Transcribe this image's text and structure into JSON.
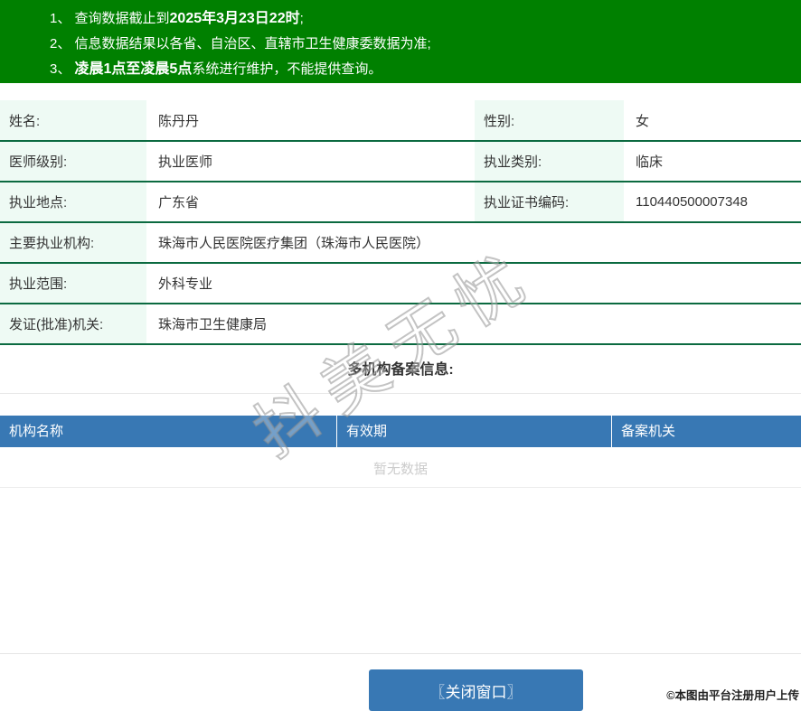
{
  "banner": {
    "lines": [
      {
        "seg1": "1、 查询数据截止到",
        "seg2": "2025年3月23日22时",
        "seg3": ";"
      },
      {
        "seg1": "2、 信息数据结果以各省、自治区、直辖市卫生健康委数据为准;",
        "seg2": "",
        "seg3": ""
      },
      {
        "seg1": "3、 ",
        "seg2": "凌晨1点至凌晨5点",
        "seg3": "系统进行维护，不能提供查询。"
      }
    ]
  },
  "info": {
    "rows": [
      {
        "cells": [
          {
            "label": "姓名:",
            "value": "陈丹丹"
          },
          {
            "label": "性别:",
            "value": "女"
          }
        ]
      },
      {
        "cells": [
          {
            "label": "医师级别:",
            "value": "执业医师"
          },
          {
            "label": "执业类别:",
            "value": "临床"
          }
        ]
      },
      {
        "cells": [
          {
            "label": "执业地点:",
            "value": "广东省"
          },
          {
            "label": "执业证书编码:",
            "value": "110440500007348"
          }
        ]
      },
      {
        "cells": [
          {
            "label": "主要执业机构:",
            "value": "珠海市人民医院医疗集团（珠海市人民医院）"
          }
        ]
      },
      {
        "cells": [
          {
            "label": "执业范围:",
            "value": "外科专业"
          }
        ]
      },
      {
        "cells": [
          {
            "label": "发证(批准)机关:",
            "value": "珠海市卫生健康局"
          }
        ]
      }
    ]
  },
  "filing": {
    "heading": "多机构备案信息:",
    "columns": [
      "机构名称",
      "有效期",
      "备案机关"
    ],
    "empty_text": "暂无数据"
  },
  "footer": {
    "close_button_label": "〖关闭窗口〗",
    "copyright": "©本图由平台注册用户上传"
  },
  "watermark": "抖美无忧",
  "colors": {
    "banner_green": "#008000",
    "label_mint": "#eefaf4",
    "divider_green": "#0b6a40",
    "header_blue": "#3878b4",
    "empty_text_gray": "#cccccc"
  }
}
